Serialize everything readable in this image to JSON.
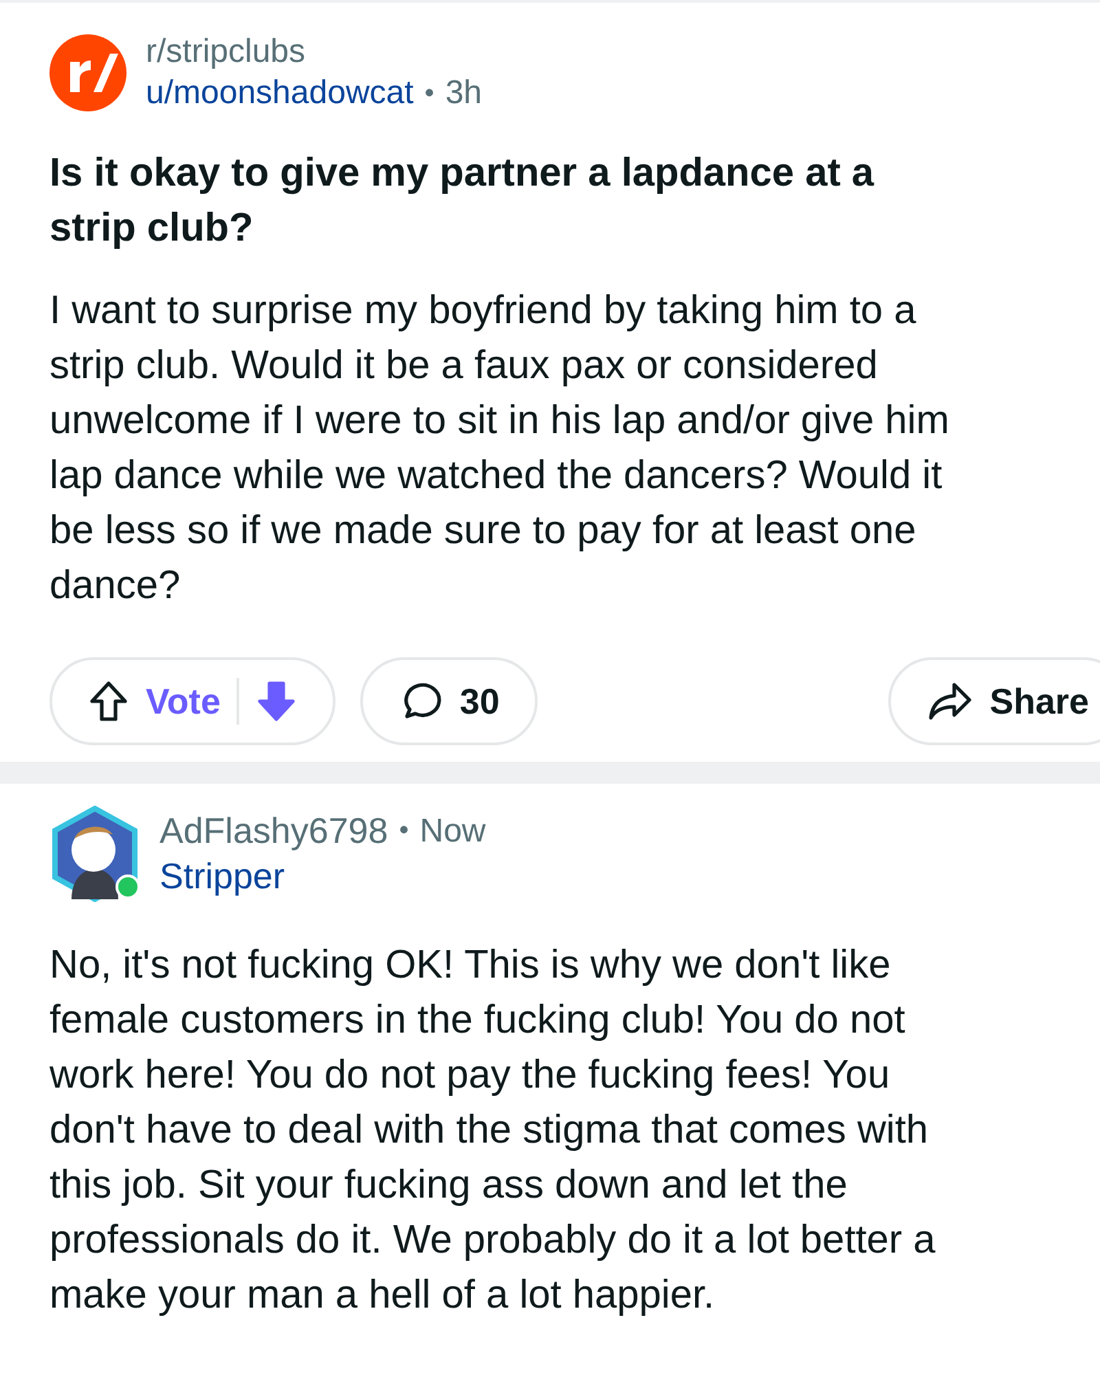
{
  "post": {
    "subreddit": "r/stripclubs",
    "author": "u/moonshadowcat",
    "separator": "•",
    "time": "3h",
    "title_lines": [
      "Is it okay to give my partner a lapdance at a",
      "strip club?"
    ],
    "body_lines": [
      "I want to surprise my boyfriend by taking him to a",
      "strip club. Would it be a faux pax or considered",
      "unwelcome if I were to sit in his lap and/or give him",
      "lap dance while we watched the dancers? Would it",
      "be less so if we made sure to pay for at least one",
      "dance?"
    ],
    "vote": {
      "label": "Vote",
      "upvoted": false,
      "downvoted": true
    },
    "comments_count": "30",
    "share": "Share"
  },
  "comment": {
    "author": "AdFlashy6798",
    "separator": "•",
    "time": "Now",
    "flair": "Stripper",
    "online": true,
    "body_lines": [
      "No, it's not fucking OK! This is why we don't like",
      "female customers in the fucking club! You do not",
      "work here! You do not pay the fucking fees! You",
      "don't have to deal with the stigma that comes with",
      "this job. Sit your fucking ass down and let the",
      "professionals do it. We probably do it a lot better a",
      "make your man a hell of a lot happier."
    ]
  }
}
